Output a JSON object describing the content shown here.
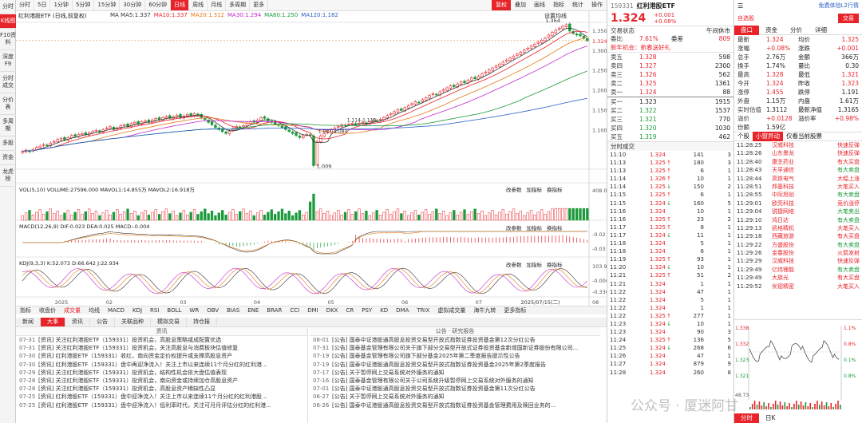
{
  "sidebar": [
    {
      "label": "分时",
      "active": false
    },
    {
      "label": "K线图",
      "active": true
    },
    {
      "label": "F10资料",
      "active": false
    },
    {
      "label": "深度F9",
      "active": false
    },
    {
      "label": "分时成交",
      "active": false
    },
    {
      "label": "分价表",
      "active": false
    },
    {
      "label": "多周期",
      "active": false
    },
    {
      "label": "多股",
      "active": false
    },
    {
      "label": "资金",
      "active": false
    },
    {
      "label": "龙虎榜",
      "active": false
    }
  ],
  "periods": [
    {
      "label": "分时",
      "active": false
    },
    {
      "label": "5日",
      "active": false
    },
    {
      "label": "1分钟",
      "active": false
    },
    {
      "label": "5分钟",
      "active": false
    },
    {
      "label": "15分钟",
      "active": false
    },
    {
      "label": "30分钟",
      "active": false
    },
    {
      "label": "60分钟",
      "active": false
    },
    {
      "label": "日线",
      "active": true
    },
    {
      "label": "周线",
      "active": false
    },
    {
      "label": "月线",
      "active": false
    },
    {
      "label": "多周期",
      "active": false
    },
    {
      "label": "更多",
      "active": false
    }
  ],
  "toolbar_right": [
    {
      "label": "复权",
      "hot": true
    },
    {
      "label": "叠加",
      "hot": false
    },
    {
      "label": "画线",
      "hot": false
    },
    {
      "label": "指标",
      "hot": false
    },
    {
      "label": "统计",
      "hot": false
    },
    {
      "label": "操作",
      "hot": false
    }
  ],
  "chart": {
    "header": "红利港股ETF (日线,前复权)",
    "ma_legend": [
      {
        "text": "MA MA5:1.337",
        "color": "#333333"
      },
      {
        "text": "MA10:1.337",
        "color": "#e8242b"
      },
      {
        "text": "MA20:1.312",
        "color": "#e67a14"
      },
      {
        "text": "MA30:1.294",
        "color": "#c02ad0"
      },
      {
        "text": "MA60:1.250",
        "color": "#1a9a3a"
      },
      {
        "text": "MA120:1.182",
        "color": "#2860c8"
      }
    ],
    "settings_label": "设置均线",
    "price_ticks": [
      "1.350",
      "1.324",
      "1.300",
      "1.250",
      "1.200",
      "1.150",
      "1.100"
    ],
    "hi_label": "1.364",
    "mid_label": "1.087-1.084",
    "mid_label2": "1.114-1.118",
    "lo_label": "1.009",
    "vol_header": "VOL(5,10) VOLUME:27596.000 MAVOL1:14.855万 MAVOL2:16.918万",
    "vol_ticks": [
      "408.00"
    ],
    "vol_links": [
      "改参数",
      "加指标",
      "换指标"
    ],
    "macd_header": "MACD(12,26,9) DIF:0.023 DEA:0.025 MACD:-0.004",
    "macd_ticks": [
      "-0.02",
      "-0.03"
    ],
    "kdj_header": "KDJ(9,3,3) K:52.073 D:66.642 J:22.934",
    "kdj_ticks": [
      "103.99",
      "-0.000",
      "-0.330"
    ],
    "date_labels": [
      "2025",
      "02",
      "03",
      "04",
      "05",
      "06",
      "07",
      "2025/07/15(二)"
    ],
    "date_axis_end": "08"
  },
  "chart_data": {
    "type": "candlestick",
    "y_range": [
      1.0,
      1.37
    ],
    "series_shape_note": "",
    "close": [
      1.045,
      1.048,
      1.044,
      1.05,
      1.055,
      1.058,
      1.062,
      1.06,
      1.066,
      1.07,
      1.075,
      1.078,
      1.074,
      1.08,
      1.085,
      1.083,
      1.088,
      1.09,
      1.087,
      1.092,
      1.095,
      1.098,
      1.094,
      1.1,
      1.104,
      1.107,
      1.1,
      1.104,
      1.11,
      1.112,
      1.108,
      1.115,
      1.118,
      1.114,
      1.12,
      1.122,
      1.118,
      1.124,
      1.128,
      1.125,
      1.13,
      1.133,
      1.128,
      1.132,
      1.136,
      1.13,
      1.134,
      1.138,
      1.135,
      1.14,
      1.136,
      1.13,
      1.125,
      1.118,
      1.112,
      1.105,
      1.1,
      1.095,
      1.09,
      1.096,
      1.102,
      1.108,
      1.105,
      1.11,
      1.116,
      1.12,
      1.118,
      1.124,
      1.13,
      1.128,
      1.122,
      1.118,
      1.114,
      1.11,
      1.105,
      1.1,
      1.095,
      1.09,
      1.085,
      1.08,
      1.084,
      1.088,
      1.085,
      1.009,
      1.07,
      1.084,
      1.09,
      1.094,
      1.1,
      1.104,
      1.108,
      1.112,
      1.11,
      1.114,
      1.116,
      1.112,
      1.116,
      1.118,
      1.114,
      1.12,
      1.124,
      1.122,
      1.126,
      1.13,
      1.135,
      1.14,
      1.145,
      1.15,
      1.148,
      1.155,
      1.16,
      1.165,
      1.17,
      1.168,
      1.175,
      1.18,
      1.186,
      1.19,
      1.188,
      1.195,
      1.2,
      1.205,
      1.21,
      1.208,
      1.215,
      1.22,
      1.218,
      1.224,
      1.23,
      1.228,
      1.234,
      1.24,
      1.245,
      1.25,
      1.255,
      1.26,
      1.265,
      1.27,
      1.275,
      1.28,
      1.285,
      1.29,
      1.295,
      1.3,
      1.305,
      1.31,
      1.315,
      1.32,
      1.325,
      1.33,
      1.338,
      1.345,
      1.35,
      1.355,
      1.36,
      1.364,
      1.348,
      1.342,
      1.338,
      1.336,
      1.33,
      1.324
    ]
  },
  "quote": {
    "code": "159331",
    "name": "红利港股ETF",
    "price": "1.324",
    "chg": "+0.001",
    "pct": "+0.08%",
    "fav_label": "免费体验L2行情",
    "add_label": "自选股",
    "trade_label": "交易",
    "status_label": "交易状态",
    "status_value": "午间休市",
    "wb_label": "委比",
    "wb_value": "7.61%",
    "wc_label": "委差",
    "wc_value": "809",
    "promo": "新年机会：新春送好礼",
    "asks": [
      {
        "lbl": "卖五",
        "p": "1.328",
        "v": "598"
      },
      {
        "lbl": "卖四",
        "p": "1.327",
        "v": "2300"
      },
      {
        "lbl": "卖三",
        "p": "1.326",
        "v": "562"
      },
      {
        "lbl": "卖二",
        "p": "1.325",
        "v": "1361"
      },
      {
        "lbl": "卖一",
        "p": "1.324",
        "v": "88"
      }
    ],
    "bids": [
      {
        "lbl": "买一",
        "p": "1.323",
        "v": "1915"
      },
      {
        "lbl": "买二",
        "p": "1.322",
        "v": "1537"
      },
      {
        "lbl": "买三",
        "p": "1.321",
        "v": "770"
      },
      {
        "lbl": "买四",
        "p": "1.320",
        "v": "1030"
      },
      {
        "lbl": "买五",
        "p": "1.319",
        "v": "462"
      }
    ],
    "stats": [
      {
        "k": "最新",
        "v": "1.324",
        "k2": "均价",
        "v2": "1.325"
      },
      {
        "k": "涨幅",
        "v": "+0.08%",
        "k2": "涨跌",
        "v2": "+0.001"
      },
      {
        "k": "总手",
        "v": "2.76万",
        "k2": "金额",
        "v2": "366万"
      },
      {
        "k": "换手",
        "v": "1.74%",
        "k2": "量比",
        "v2": "0.30"
      },
      {
        "k": "最高",
        "v": "1.328",
        "k2": "最低",
        "v2": "1.321"
      },
      {
        "k": "今开",
        "v": "1.324",
        "k2": "昨收",
        "v2": "1.323"
      },
      {
        "k": "涨停",
        "v": "1.455",
        "k2": "跌停",
        "v2": "1.191"
      },
      {
        "k": "外盘",
        "v": "1.15万",
        "k2": "内盘",
        "v2": "1.61万"
      },
      {
        "k": "实时估值",
        "v": "1.3112",
        "k2": "最新净值",
        "v2": "1.3165"
      },
      {
        "k": "溢价",
        "v": "+0.0128",
        "k2": "溢价率",
        "v2": "+0.98%"
      },
      {
        "k": "份额",
        "v": "1.59亿",
        "k2": "",
        "v2": ""
      }
    ],
    "tabs": [
      {
        "label": "盘口",
        "active": true
      },
      {
        "label": "资金",
        "active": false
      },
      {
        "label": "分价",
        "active": false
      },
      {
        "label": "详细",
        "active": false
      }
    ],
    "trades_title": "分时成交",
    "trades": [
      {
        "t": "11:10",
        "p": "1.324",
        "a": "",
        "v": "141",
        "c": "3"
      },
      {
        "t": "11:13",
        "p": "1.325",
        "a": "↑",
        "v": "180",
        "c": "3"
      },
      {
        "t": "11:13",
        "p": "1.325",
        "a": "↑",
        "v": "6",
        "c": "1"
      },
      {
        "t": "11:14",
        "p": "1.326",
        "a": "↑",
        "v": "10",
        "c": "1"
      },
      {
        "t": "11:14",
        "p": "1.325",
        "a": "↓",
        "v": "150",
        "c": "2"
      },
      {
        "t": "11:15",
        "p": "1.325",
        "a": "↑",
        "v": "6",
        "c": "1"
      },
      {
        "t": "11:15",
        "p": "1.324",
        "a": "↓",
        "v": "160",
        "c": "5"
      },
      {
        "t": "11:16",
        "p": "1.324",
        "a": "",
        "v": "10",
        "c": "1"
      },
      {
        "t": "11:16",
        "p": "1.325",
        "a": "↑",
        "v": "23",
        "c": "2"
      },
      {
        "t": "11:17",
        "p": "1.325",
        "a": "↑",
        "v": "8",
        "c": "1"
      },
      {
        "t": "11:17",
        "p": "1.324",
        "a": "↓",
        "v": "11",
        "c": "1"
      },
      {
        "t": "11:18",
        "p": "1.324",
        "a": "",
        "v": "5",
        "c": "1"
      },
      {
        "t": "11:18",
        "p": "1.324",
        "a": "",
        "v": "6",
        "c": "1"
      },
      {
        "t": "11:19",
        "p": "1.325",
        "a": "↑",
        "v": "93",
        "c": "1"
      },
      {
        "t": "11:20",
        "p": "1.324",
        "a": "↓",
        "v": "10",
        "c": "1"
      },
      {
        "t": "11:21",
        "p": "1.325",
        "a": "↑",
        "v": "51",
        "c": "2"
      },
      {
        "t": "11:21",
        "p": "1.324",
        "a": "",
        "v": "1",
        "c": "1"
      },
      {
        "t": "11:22",
        "p": "1.324",
        "a": "",
        "v": "47",
        "c": "1"
      },
      {
        "t": "11:22",
        "p": "1.324",
        "a": "",
        "v": "5",
        "c": "1"
      },
      {
        "t": "11:22",
        "p": "1.324",
        "a": "",
        "v": "1",
        "c": "1"
      },
      {
        "t": "11:22",
        "p": "1.325",
        "a": "↑",
        "v": "277",
        "c": "1"
      },
      {
        "t": "11:23",
        "p": "1.324",
        "a": "↓",
        "v": "10",
        "c": "1"
      },
      {
        "t": "11:23",
        "p": "1.324",
        "a": "",
        "v": "90",
        "c": "3"
      },
      {
        "t": "11:24",
        "p": "1.325",
        "a": "↑",
        "v": "136",
        "c": "5"
      },
      {
        "t": "11:25",
        "p": "1.324",
        "a": "↓",
        "v": "268",
        "c": "6"
      },
      {
        "t": "11:26",
        "p": "1.324",
        "a": "",
        "v": "47",
        "c": "1"
      },
      {
        "t": "11:27",
        "p": "1.324",
        "a": "",
        "v": "879",
        "c": "9"
      },
      {
        "t": "11:28",
        "p": "1.324",
        "a": "",
        "v": "260",
        "c": "8"
      }
    ],
    "flash_tabs": [
      {
        "label": "个股",
        "active": false
      },
      {
        "label": "小窗异动",
        "active": true
      },
      {
        "label": "仅看当前股票",
        "active": false
      }
    ],
    "flash_title": "",
    "flash": [
      {
        "t": "11:28:25",
        "n": "汉威科技",
        "ty": "快速反弹"
      },
      {
        "t": "11:28:26",
        "n": "山东墨龙",
        "ty": "快速反弹"
      },
      {
        "t": "11:28:40",
        "n": "康芝药业",
        "ty": "有大买盘"
      },
      {
        "t": "11:28:43",
        "n": "天孚通信",
        "ty": "有大卖盘"
      },
      {
        "t": "11:28:44",
        "n": "高铁电气",
        "ty": "大幅上涨"
      },
      {
        "t": "11:28:51",
        "n": "邦基科技",
        "ty": "大笔买入"
      },
      {
        "t": "11:28:55",
        "n": "中际旭创",
        "ty": "有大卖盘"
      },
      {
        "t": "11:29:01",
        "n": "欧亮科技",
        "ty": "竞价涨停"
      },
      {
        "t": "11:29:04",
        "n": "锐捷网络",
        "ty": "大笔卖出"
      },
      {
        "t": "11:29:10",
        "n": "鸿日达",
        "ty": "有大卖盘"
      },
      {
        "t": "11:29:13",
        "n": "凯格精机",
        "ty": "大笔买入"
      },
      {
        "t": "11:29:18",
        "n": "西藏旅游",
        "ty": "有大买盘"
      },
      {
        "t": "11:29:22",
        "n": "方盛股份",
        "ty": "有大卖盘"
      },
      {
        "t": "11:29:26",
        "n": "金春股份",
        "ty": "火箭发射"
      },
      {
        "t": "11:29:29",
        "n": "汉威科技",
        "ty": "快速反弹"
      },
      {
        "t": "11:29:49",
        "n": "亿纬锂能",
        "ty": "有大卖盘"
      },
      {
        "t": "11:29:49",
        "n": "大族光",
        "ty": "有大买盘"
      },
      {
        "t": "11:29:52",
        "n": "优德精密",
        "ty": "大笔买入"
      }
    ],
    "mini_ticks_left": [
      "1.338",
      "1.332",
      "1.323",
      "1.321"
    ],
    "mini_ticks_right": [
      "1.1%",
      "0.8%",
      "0.1%",
      "0.8%"
    ],
    "mini_vol": "48.73",
    "bottom_tabs": [
      {
        "label": "分时",
        "active": true
      },
      {
        "label": "日K",
        "active": false
      }
    ]
  },
  "news": {
    "tabs": [
      {
        "label": "新闻",
        "active": false
      },
      {
        "label": "大事",
        "active": true
      },
      {
        "label": "资讯",
        "active": false
      },
      {
        "label": "公告",
        "active": false
      },
      {
        "label": "关联品种",
        "active": false
      },
      {
        "label": "模拟交易",
        "active": false
      },
      {
        "label": "持仓报",
        "active": false
      }
    ],
    "left_title": "资讯",
    "right_title": "公告 · 研究报告",
    "left": [
      {
        "d": "07-31",
        "t": "[资讯] 关注红利港股ETF（159331）投资机会，高股息策略或成配置优选"
      },
      {
        "d": "07-31",
        "t": "[资讯] 关注红利港股ETF（159331）投资机会，关注高股息与消费板块估值修复"
      },
      {
        "d": "07-30",
        "t": "[资讯] 红利港股ETF（159331）收红，南向资金定价权提升或支撑高股息资产"
      },
      {
        "d": "07-30",
        "t": "[资讯] 红利港股ETF（159331）盘中再迎净流入！关注上市以来连续11个月分红的红利港..."
      },
      {
        "d": "07-29",
        "t": "[资讯] 关注红利港股ETF（159331）投资机会，结构性机会依大盘估值表现"
      },
      {
        "d": "07-28",
        "t": "[资讯] 关注红利港股ETF（159331）投资机会，南向资金或持续加仓高股息资产"
      },
      {
        "d": "07-28",
        "t": "[资讯] 关注红利港股ETF（159331）投资机会，高股息资产稀缺性凸显"
      },
      {
        "d": "07-25",
        "t": "[资讯] 红利港股ETF（159331）盘中迎净流入！关注上市以来连续11个月分红的红利港股..."
      },
      {
        "d": "07-25",
        "t": "[资讯] 红利港股ETF（159331）盘中迎净流入！低利率时代，关注可月月评估分红的红利港..."
      }
    ],
    "right": [
      {
        "d": "08-01",
        "t": "[公告] 国泰中证港股通高股息投资交易型开放式指数证券投资基金第12次分红公告"
      },
      {
        "d": "07-31",
        "t": "[公告] 国泰基金管理有限公司关于旗下部分交易型开放式证券投资基金新增国新证券股份有限公司..."
      },
      {
        "d": "07-19",
        "t": "[公告] 国泰基金管理有限公司旗下部分基金2025年第二季度报告提示性公告"
      },
      {
        "d": "07-19",
        "t": "[公告] 国泰中证港股通高股息投资交易型开放式指数证券投资基金2025年第2季度报告"
      },
      {
        "d": "07-17",
        "t": "[公告] 关于暂停网上交易系统对外服务的通知"
      },
      {
        "d": "07-16",
        "t": "[公告] 国泰基金管理有限公司关于公司系统升级暂停网上交易系统对外服务的通知"
      },
      {
        "d": "07-01",
        "t": "[公告] 国泰中证港股通高股息投资交易型开放式指数证券投资基金第11次分红公告"
      },
      {
        "d": "06-27",
        "t": "[公告] 关于暂停网上交易系统对外服务的通知"
      },
      {
        "d": "06-26",
        "t": "[公告] 国泰中证港股通高股息投资交易型开放式指数证券投资基金管理费用及赎回业务的..."
      }
    ]
  },
  "watermark": "公众号 · 厦迷阿甘",
  "colors": {
    "up": "#e8242b",
    "down": "#1a9a3a",
    "accent": "#e8242b"
  }
}
